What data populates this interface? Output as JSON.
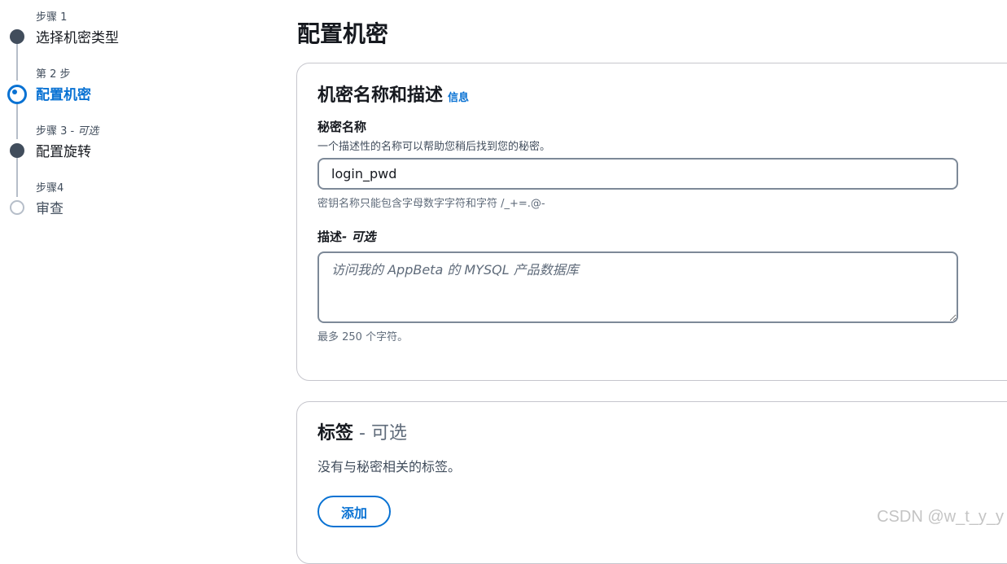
{
  "stepper": {
    "steps": [
      {
        "sub": "步骤 1",
        "sub_optional": "",
        "title": "选择机密类型",
        "status": "done"
      },
      {
        "sub": "第 2 步",
        "sub_optional": "",
        "title": "配置机密",
        "status": "current"
      },
      {
        "sub": "步骤 3 - ",
        "sub_optional": "可选",
        "title": "配置旋转",
        "status": "done"
      },
      {
        "sub": "步骤4",
        "sub_optional": "",
        "title": "审查",
        "status": "pending"
      }
    ]
  },
  "page": {
    "title": "配置机密"
  },
  "secret_section": {
    "title": "机密名称和描述",
    "info_link": "信息",
    "name_label": "秘密名称",
    "name_description": "一个描述性的名称可以帮助您稍后找到您的秘密。",
    "name_value": "login_pwd",
    "name_constraint": "密钥名称只能包含字母数字字符和字符 /_+=.@-",
    "desc_label": "描述",
    "desc_label_optional": "- 可选",
    "desc_placeholder": "访问我的 AppBeta 的 MYSQL 产品数据库",
    "desc_constraint": "最多 250 个字符。"
  },
  "tags_section": {
    "title": "标签",
    "title_optional": " - 可选",
    "description": "没有与秘密相关的标签。",
    "add_label": "添加"
  },
  "watermark": "CSDN @w_t_y_y",
  "colors": {
    "accent": "#0972d3",
    "step_done": "#414d5c",
    "step_pending": "#b6bec9",
    "border": "#7d8998"
  }
}
